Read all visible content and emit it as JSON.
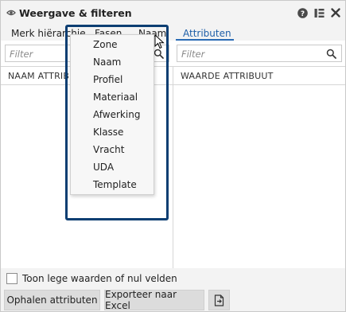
{
  "window": {
    "title": "Weergave & filteren",
    "icons": [
      "eye-icon",
      "help-icon",
      "layout-icon",
      "close-icon"
    ]
  },
  "tabs": [
    {
      "label": "Merk hiërarchie"
    },
    {
      "label": "Fasen"
    },
    {
      "label": "Naam"
    },
    {
      "label": "Attributen",
      "active": true
    }
  ],
  "filters": {
    "left_placeholder": "Filter",
    "right_placeholder": "Filter"
  },
  "grid": {
    "col_name": "NAAM ATTRIBUUT",
    "col_value": "WAARDE ATTRIBUUT"
  },
  "dropdown": {
    "items": [
      "Zone",
      "Naam",
      "Profiel",
      "Materiaal",
      "Afwerking",
      "Klasse",
      "Vracht",
      "UDA",
      "Template"
    ]
  },
  "options": {
    "show_empty_label": "Toon lege waarden of nul velden",
    "show_empty_checked": false
  },
  "buttons": {
    "fetch": "Ophalen attributen",
    "export": "Exporteer naar Excel",
    "export_icon": "export-icon"
  },
  "colors": {
    "accent": "#2a6bb5",
    "highlight_frame": "#0c3e72"
  }
}
